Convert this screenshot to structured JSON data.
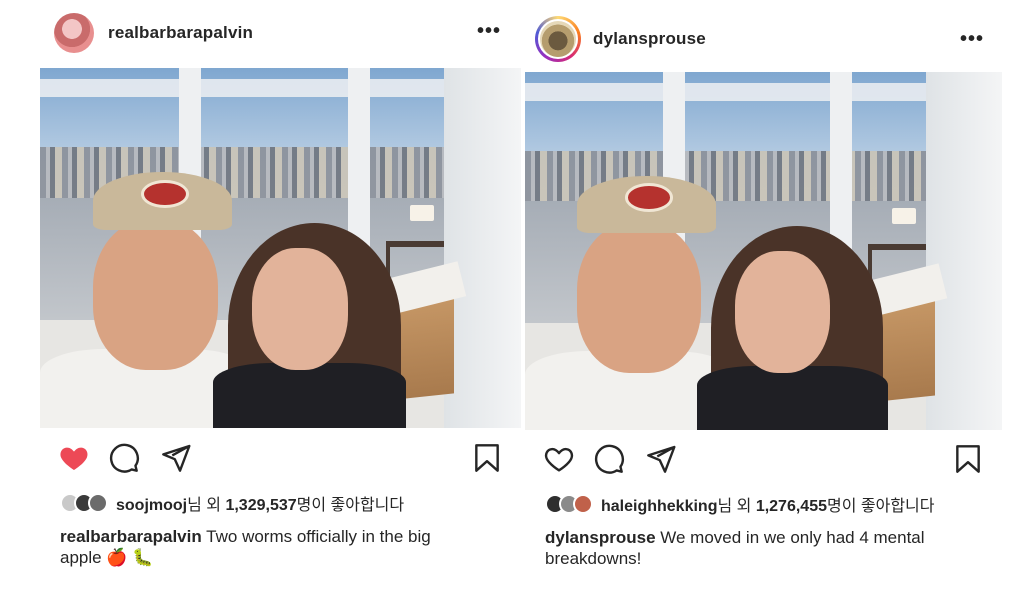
{
  "colors": {
    "heart_liked": "#ed4956",
    "text": "#262626"
  },
  "posts": [
    {
      "username": "realbarbarapalvin",
      "more_label": "•••",
      "liked": true,
      "likes": {
        "first_liker": "soojmooj",
        "suffix_before": "님 외 ",
        "count": "1,329,537",
        "suffix_after": "명이 좋아합니다"
      },
      "caption": {
        "username": "realbarbarapalvin",
        "text": " Two worms officially in the big apple 🍎 🐛"
      }
    },
    {
      "username": "dylansprouse",
      "more_label": "•••",
      "liked": false,
      "likes": {
        "first_liker": "haleighhekking",
        "suffix_before": "님 외 ",
        "count": "1,276,455",
        "suffix_after": "명이 좋아합니다"
      },
      "caption": {
        "username": "dylansprouse",
        "text": " We moved in we only had 4 mental breakdowns!"
      }
    }
  ]
}
